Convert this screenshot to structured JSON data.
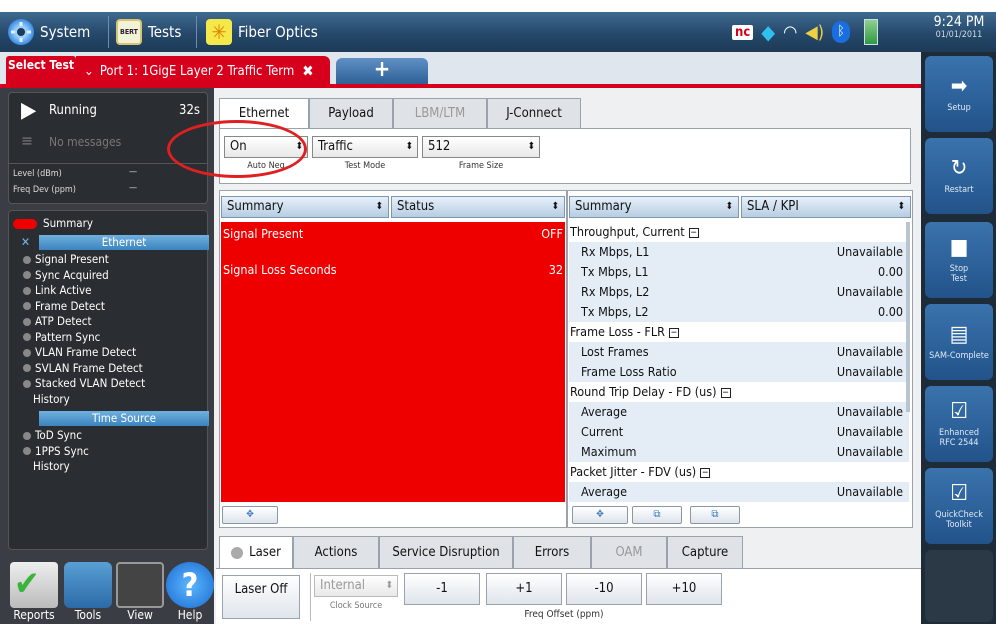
{
  "topbar": {
    "system_label": "System",
    "tests_label": "Tests",
    "tests_icon_text": "BERT",
    "fiber_label": "Fiber Optics",
    "time": "9:24 PM",
    "date": "01/01/2011",
    "status_icons": [
      "nc-icon",
      "sync-icon",
      "wifi-icon",
      "speaker-icon",
      "bluetooth-icon",
      "battery-icon"
    ]
  },
  "tabs": {
    "select_test": "Select Test",
    "port_tab": "Port 1: 1GigE Layer 2 Traffic Term",
    "add": "+"
  },
  "status": {
    "state": "Running",
    "elapsed": "32s",
    "messages": "No messages",
    "level_label": "Level (dBm)",
    "level_value": "—",
    "freq_label": "Freq Dev (ppm)",
    "freq_value": "—"
  },
  "tree": {
    "summary": "Summary",
    "ethernet_header": "Ethernet",
    "ethernet_items": [
      "Signal Present",
      "Sync Acquired",
      "Link Active",
      "Frame Detect",
      "ATP Detect",
      "Pattern Sync",
      "VLAN Frame Detect",
      "SVLAN Frame Detect",
      "Stacked VLAN Detect",
      "History"
    ],
    "time_header": "Time Source",
    "time_items": [
      "ToD Sync",
      "1PPS Sync",
      "History"
    ]
  },
  "bottom_left": [
    "Reports",
    "Tools",
    "View",
    "Help"
  ],
  "main_tabs": [
    {
      "label": "Ethernet",
      "state": "active"
    },
    {
      "label": "Payload",
      "state": "normal"
    },
    {
      "label": "LBM/LTM",
      "state": "disabled"
    },
    {
      "label": "J-Connect",
      "state": "normal"
    }
  ],
  "config": {
    "auto_neg": {
      "value": "On",
      "caption": "Auto Neg"
    },
    "test_mode": {
      "value": "Traffic",
      "caption": "Test Mode"
    },
    "frame_size": {
      "value": "512",
      "caption": "Frame Size"
    }
  },
  "left_table": {
    "col1": "Summary",
    "col2": "Status",
    "rows": [
      {
        "label": "Signal Present",
        "value": "OFF"
      },
      {
        "label": "Signal Loss Seconds",
        "value": "32"
      }
    ]
  },
  "right_table": {
    "col1": "Summary",
    "col2": "SLA / KPI",
    "rows": [
      {
        "label": "Throughput, Current",
        "value": "",
        "group": true
      },
      {
        "label": "Rx Mbps, L1",
        "value": "Unavailable"
      },
      {
        "label": "Tx Mbps, L1",
        "value": "0.00"
      },
      {
        "label": "Rx Mbps, L2",
        "value": "Unavailable"
      },
      {
        "label": "Tx Mbps, L2",
        "value": "0.00"
      },
      {
        "label": "Frame Loss - FLR",
        "value": "",
        "group": true
      },
      {
        "label": "Lost Frames",
        "value": "Unavailable"
      },
      {
        "label": "Frame Loss Ratio",
        "value": "Unavailable"
      },
      {
        "label": "Round Trip Delay - FD (us)",
        "value": "",
        "group": true
      },
      {
        "label": "Average",
        "value": "Unavailable"
      },
      {
        "label": "Current",
        "value": "Unavailable"
      },
      {
        "label": "Maximum",
        "value": "Unavailable"
      },
      {
        "label": "Packet Jitter - FDV (us)",
        "value": "",
        "group": true
      },
      {
        "label": "Average",
        "value": "Unavailable"
      }
    ]
  },
  "bottom_tabs": [
    {
      "label": "Laser",
      "state": "active"
    },
    {
      "label": "Actions",
      "state": "normal"
    },
    {
      "label": "Service Disruption",
      "state": "normal"
    },
    {
      "label": "Errors",
      "state": "normal"
    },
    {
      "label": "OAM",
      "state": "disabled"
    },
    {
      "label": "Capture",
      "state": "normal"
    }
  ],
  "actions_row": {
    "laser_off": "Laser Off",
    "clock_source_value": "Internal",
    "clock_source_caption": "Clock Source",
    "freq_buttons": [
      "-1",
      "+1",
      "-10",
      "+10"
    ],
    "freq_caption": "Freq Offset (ppm)"
  },
  "right_sidebar": [
    {
      "label": "Setup",
      "icon": "arrow-right-icon"
    },
    {
      "label": "Restart",
      "icon": "restart-icon"
    },
    {
      "label": "Stop Test",
      "icon": "stop-icon"
    },
    {
      "label": "SAM-Complete",
      "icon": "sam-icon"
    },
    {
      "label": "Enhanced RFC 2544",
      "icon": "check-plus-icon"
    },
    {
      "label": "QuickCheck Toolkit",
      "icon": "check-icon"
    }
  ],
  "colors": {
    "accent_red": "#d6001c",
    "status_red": "#ee0000",
    "header_blue": "#25486a",
    "button_blue": "#3a73ad"
  }
}
